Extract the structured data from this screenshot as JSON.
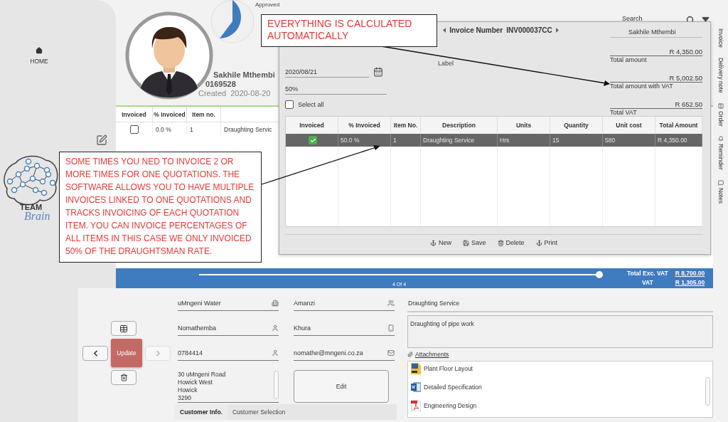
{
  "sidebar": {
    "nav": [
      {
        "label": "HOME"
      }
    ],
    "logo": {
      "word_1": "TEAM",
      "word_2": "Brain"
    }
  },
  "header": {
    "chart_label": "Approved",
    "search": {
      "placeholder": "Search"
    }
  },
  "profile": {
    "name": "Sakhile Mthembi",
    "number": "0169528",
    "created_label": "Created",
    "created_date": "2020-08-20"
  },
  "items_table": {
    "checkbox_column": "Invoiced",
    "columns": [
      "% Invoiced",
      "Item no."
    ],
    "rows": [
      {
        "invoiced": false,
        "cells": [
          "0.0 %",
          "1",
          "Draughting Servic"
        ]
      }
    ]
  },
  "invoice_dialog": {
    "customer": "Sakhile Mthembi",
    "title_label": "Invoice Number",
    "invoice_number": "INV000037CC",
    "date": "2020/08/21",
    "label": "Label",
    "percent": "50%",
    "select_all": {
      "label": "Select all",
      "checked": false
    },
    "totals": [
      {
        "value": "R 4,350.00",
        "caption": "Total amount"
      },
      {
        "value": "R 5,002.50",
        "caption": "Total amount with VAT"
      },
      {
        "value": "R 652.50",
        "caption": "Total VAT"
      }
    ],
    "table": {
      "checkbox_column": "Invoiced",
      "columns": [
        "% Invoiced",
        "Item No.",
        "Description",
        "Units",
        "Quantity",
        "Unit cost",
        "Total Amount"
      ],
      "rows": [
        {
          "selected": true,
          "invoiced": true,
          "cells": [
            "50.0 %",
            "1",
            "Draughting Service",
            "Hrs",
            "15",
            "580",
            "R 4,350.00"
          ]
        }
      ]
    },
    "actions": [
      "New",
      "Save",
      "Delete",
      "Print"
    ]
  },
  "pager": {
    "level": 1,
    "reading": "4 Of 4"
  },
  "summary": [
    {
      "label": "Total Exc. VAT",
      "value": "R 8,700.00"
    },
    {
      "label": "VAT",
      "value": "R 1,305.00"
    }
  ],
  "side_tabs": [
    {
      "label": "Invoice"
    },
    {
      "label": "Delivery note"
    },
    {
      "label": "Order"
    },
    {
      "label": "Reminder"
    },
    {
      "label": "Notes"
    }
  ],
  "record_nav": {
    "update_label": "Update",
    "next_disabled": true
  },
  "customer": {
    "fields": [
      {
        "value": "uMngeni Water"
      },
      {
        "value": "Amanzi"
      },
      {
        "value": "Nomathemba"
      },
      {
        "value": "Khura"
      },
      {
        "value": "0784414"
      },
      {
        "value": "nomathe@mngeni.co.za"
      }
    ],
    "address": "30 uMngeni Road\nHowick West\nHowick\n3290",
    "edit_label": "Edit",
    "tabs": [
      {
        "label": "Customer Info.",
        "selected": true
      },
      {
        "label": "Customer Selection",
        "selected": false
      }
    ]
  },
  "item_detail": {
    "title": "Draughting Service",
    "description": "Draughting of pipe work",
    "attachments_label": "Attachments",
    "attachments": [
      {
        "name": "Plant Floor Layout",
        "kind": "dwg"
      },
      {
        "name": "Detailed Specification",
        "kind": "word"
      },
      {
        "name": "Engineering Design",
        "kind": "pdf"
      }
    ]
  },
  "annotations": [
    {
      "text": "EVERYTHING IS CALCULATED AUTOMATICALLY"
    },
    {
      "text": "SOME TIMES YOU NED TO INVOICE 2 OR MORE TIMES FOR ONE QUOTATIONS. THE SOFTWARE ALLOWS YOU TO HAVE MULTIPLE INVOICES LINKED TO ONE QUOTATIONS AND TRACKS INVOICING OF EACH QUOTATION ITEM. YOU CAN INVOICE PERCENTAGES OF ALL ITEMS IN THIS CASE WE ONLY INVOICED 50% OF THE DRAUGHTSMAN RATE."
    }
  ]
}
